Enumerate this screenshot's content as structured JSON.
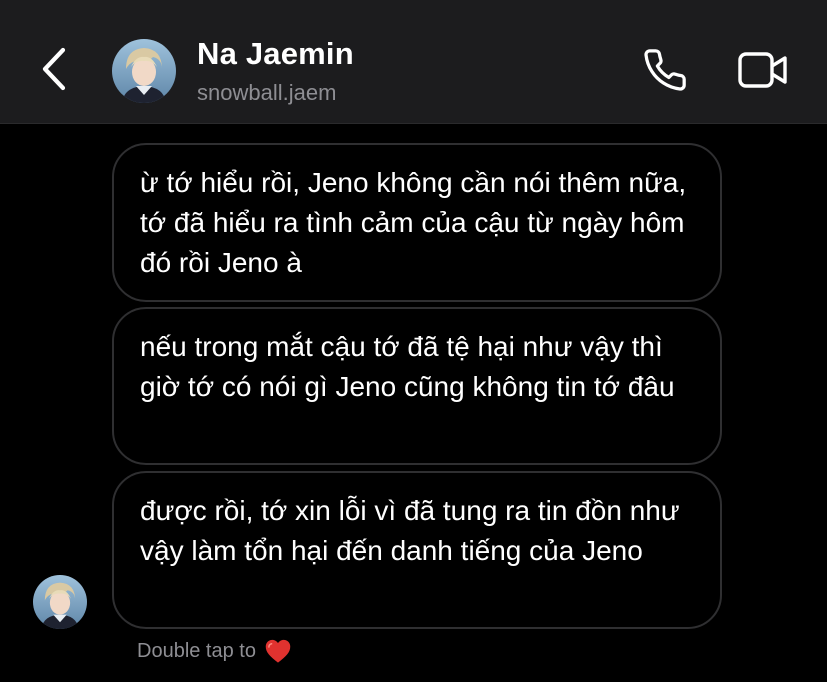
{
  "header": {
    "name": "Na Jaemin",
    "username": "snowball.jaem"
  },
  "messages": [
    {
      "text": "ừ tớ hiểu rồi, Jeno không cần nói thêm nữa, tớ đã hiểu ra tình cảm của cậu từ ngày hôm đó rồi Jeno à"
    },
    {
      "text": "nếu trong mắt cậu tớ đã tệ hại như vậy thì giờ tớ có nói gì Jeno cũng không tin tớ đâu"
    },
    {
      "text": "được rồi, tớ xin lỗi vì đã tung ra tin đồn như vậy làm tổn hại đến danh tiếng của Jeno"
    }
  ],
  "footer": {
    "hint": "Double tap to",
    "heart_icon": "heart-icon"
  },
  "icons": {
    "back": "chevron-left-icon",
    "call": "phone-icon",
    "video": "video-camera-icon"
  },
  "colors": {
    "header_bg": "#1c1c1e",
    "bubble_border": "#2f2f31",
    "secondary_text": "#8e8e93",
    "heart": "#e0322f"
  }
}
